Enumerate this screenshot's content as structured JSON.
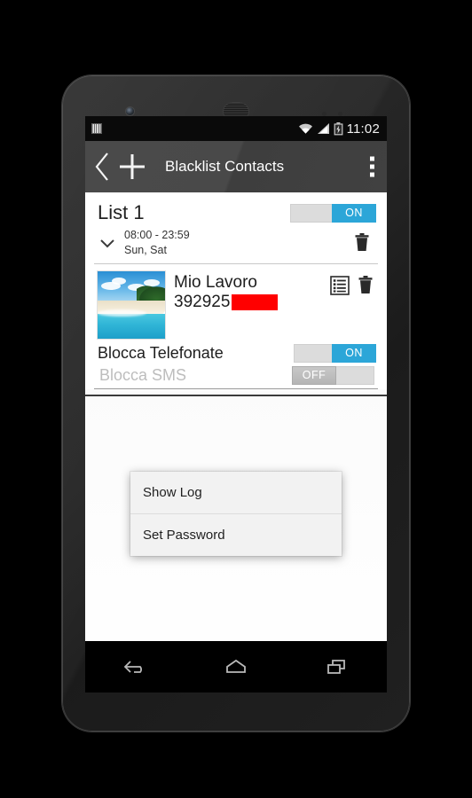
{
  "statusbar": {
    "notification_icon": "barcode-icon",
    "wifi_icon": "wifi-icon",
    "signal_icon": "signal-bars-icon",
    "battery_icon": "battery-charging-icon",
    "time": "11:02"
  },
  "actionbar": {
    "back_icon": "chevron-left-icon",
    "add_icon": "plus-icon",
    "title": "Blacklist Contacts",
    "overflow_icon": "overflow-menu-icon"
  },
  "list": {
    "name": "List 1",
    "enabled_switch": {
      "label": "ON",
      "state": "on"
    },
    "expander_icon": "chevron-down-icon",
    "schedule_time": "08:00 - 23:59",
    "schedule_days": "Sun, Sat",
    "delete_icon": "trash-icon"
  },
  "contact": {
    "avatar": "beach-photo",
    "name": "Mio Lavoro",
    "number": "392925",
    "number_redacted": true,
    "details_icon": "list-details-icon",
    "delete_icon": "trash-icon"
  },
  "options": [
    {
      "label": "Blocca Telefonate",
      "switch_label": "ON",
      "state": "on"
    },
    {
      "label": "Blocca SMS",
      "switch_label": "OFF",
      "state": "off"
    }
  ],
  "popup_menu": {
    "items": [
      {
        "label": "Show Log"
      },
      {
        "label": "Set Password"
      }
    ]
  },
  "navbar": {
    "back_icon": "nav-back-icon",
    "home_icon": "nav-home-icon",
    "recents_icon": "nav-recents-icon"
  },
  "colors": {
    "accent_on": "#2ca6d8",
    "redaction": "#ff0000",
    "actionbar": "#454545"
  }
}
